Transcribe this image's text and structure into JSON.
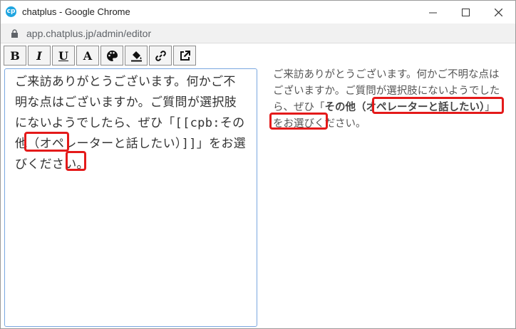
{
  "window": {
    "title": "chatplus - Google Chrome",
    "app_icon_text": "cp",
    "url": "app.chatplus.jp/admin/editor"
  },
  "toolbar": {
    "bold": "B",
    "italic": "I",
    "underline": "U",
    "font_color": "A",
    "icons": [
      "bold-icon",
      "italic-icon",
      "underline-icon",
      "font-color-icon",
      "palette-icon",
      "fill-bucket-icon",
      "link-icon",
      "external-link-icon"
    ]
  },
  "editor": {
    "text": "ご来訪ありがとうございます。何かご不明な点はございますか。ご質問が選択肢にないようでしたら、ぜひ「[[cpb:その他（オペレーターと話したい）]]」をお選びください。"
  },
  "preview": {
    "text_before": "ご来訪ありがとうございます。何かご不明な点はございますか。ご質問が選択肢にないようでしたら、ぜひ「",
    "choice_label": "その他（オペレーターと話したい）",
    "text_after": "」をお選びください。"
  },
  "colors": {
    "highlight": "#e41a1a",
    "editor_border": "#7aa7e0"
  }
}
